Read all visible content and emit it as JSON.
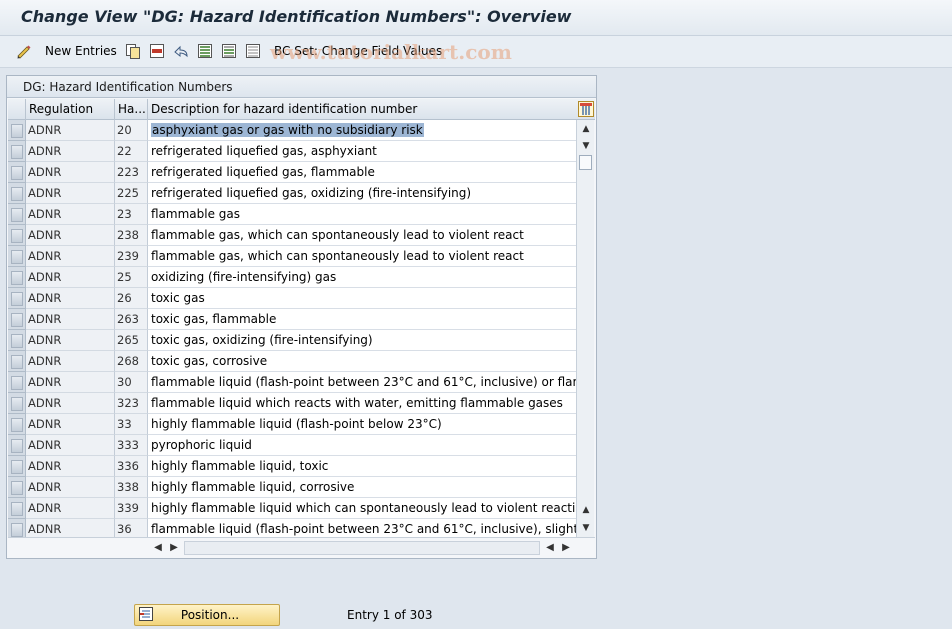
{
  "title": "Change View \"DG: Hazard Identification Numbers\": Overview",
  "watermark": "www.tutorialkart.com",
  "toolbar": {
    "new_entries_label": "New Entries",
    "bc_set_label": "BC Set: Change Field Values",
    "icons": [
      "edit-pen-icon",
      "copy-icon",
      "delete-icon",
      "undo-icon",
      "select-all-icon",
      "select-block-icon",
      "deselect-icon",
      "bc-set-icon"
    ]
  },
  "panel": {
    "title": "DG: Hazard Identification Numbers",
    "columns": [
      "Regulation",
      "Ha...",
      "Description for hazard identification number"
    ],
    "rows": [
      {
        "regulation": "ADNR",
        "hazard": "20",
        "description": "asphyxiant gas or gas with no subsidiary risk"
      },
      {
        "regulation": "ADNR",
        "hazard": "22",
        "description": "refrigerated liquefied gas, asphyxiant"
      },
      {
        "regulation": "ADNR",
        "hazard": "223",
        "description": "refrigerated liquefied gas, flammable"
      },
      {
        "regulation": "ADNR",
        "hazard": "225",
        "description": "refrigerated liquefied gas, oxidizing (fire-intensifying)"
      },
      {
        "regulation": "ADNR",
        "hazard": "23",
        "description": "flammable gas"
      },
      {
        "regulation": "ADNR",
        "hazard": "238",
        "description": "flammable gas, which can spontaneously lead to violent react"
      },
      {
        "regulation": "ADNR",
        "hazard": "239",
        "description": "flammable gas, which can spontaneously lead to violent react"
      },
      {
        "regulation": "ADNR",
        "hazard": "25",
        "description": "oxidizing (fire-intensifying) gas"
      },
      {
        "regulation": "ADNR",
        "hazard": "26",
        "description": "toxic gas"
      },
      {
        "regulation": "ADNR",
        "hazard": "263",
        "description": "toxic gas, flammable"
      },
      {
        "regulation": "ADNR",
        "hazard": "265",
        "description": "toxic gas, oxidizing (fire-intensifying)"
      },
      {
        "regulation": "ADNR",
        "hazard": "268",
        "description": "toxic gas, corrosive"
      },
      {
        "regulation": "ADNR",
        "hazard": "30",
        "description": "flammable liquid (flash-point between 23°C and 61°C, inclusive) or flammable l"
      },
      {
        "regulation": "ADNR",
        "hazard": "323",
        "description": "flammable liquid which reacts with water, emitting flammable gases"
      },
      {
        "regulation": "ADNR",
        "hazard": "33",
        "description": "highly flammable liquid (flash-point below 23°C)"
      },
      {
        "regulation": "ADNR",
        "hazard": "333",
        "description": "pyrophoric liquid"
      },
      {
        "regulation": "ADNR",
        "hazard": "336",
        "description": "highly flammable liquid, toxic"
      },
      {
        "regulation": "ADNR",
        "hazard": "338",
        "description": "highly flammable liquid, corrosive"
      },
      {
        "regulation": "ADNR",
        "hazard": "339",
        "description": "highly flammable liquid which can spontaneously lead to violent reaction"
      },
      {
        "regulation": "ADNR",
        "hazard": "36",
        "description": "flammable liquid (flash-point between 23°C and 61°C, inclusive), slightly toxic,"
      }
    ]
  },
  "footer": {
    "position_label": "Position...",
    "entry_text": "Entry 1 of 303"
  }
}
